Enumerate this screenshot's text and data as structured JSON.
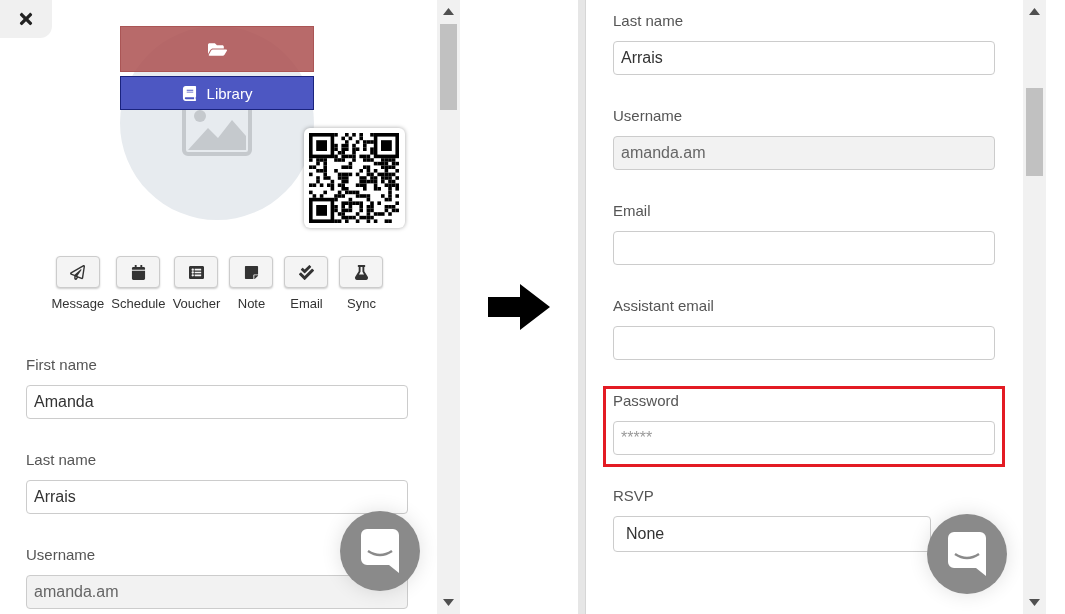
{
  "left_panel": {
    "upload": {
      "library_label": "Library"
    },
    "actions": [
      {
        "kind": "send",
        "label": "Message"
      },
      {
        "kind": "calendar",
        "label": "Schedule"
      },
      {
        "kind": "list",
        "label": "Voucher"
      },
      {
        "kind": "note",
        "label": "Note"
      },
      {
        "kind": "check",
        "label": "Email"
      },
      {
        "kind": "flask",
        "label": "Sync"
      }
    ],
    "fields": [
      {
        "kind": "text",
        "label": "First name",
        "value": "Amanda",
        "highlighted": false
      },
      {
        "kind": "text",
        "label": "Last name",
        "value": "Arrais",
        "highlighted": false
      },
      {
        "kind": "readonly",
        "label": "Username",
        "value": "amanda.am",
        "highlighted": false
      }
    ]
  },
  "right_panel": {
    "fields": [
      {
        "kind": "text",
        "label": "Last name",
        "value": "Arrais",
        "highlighted": false
      },
      {
        "kind": "readonly",
        "label": "Username",
        "value": "amanda.am",
        "highlighted": false
      },
      {
        "kind": "text",
        "label": "Email",
        "highlighted": false
      },
      {
        "kind": "text",
        "label": "Assistant email",
        "highlighted": false
      },
      {
        "kind": "password",
        "label": "Password",
        "placeholder": "*****",
        "highlighted": true
      },
      {
        "kind": "select",
        "label": "RSVP",
        "value": "None",
        "highlighted": false
      }
    ]
  }
}
